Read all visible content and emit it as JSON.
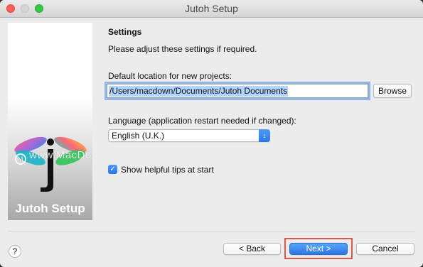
{
  "window": {
    "title": "Jutoh Setup"
  },
  "sidebar": {
    "label": "Jutoh Setup",
    "watermark": "www.MacDown.com",
    "watermark_mark": "M"
  },
  "settings": {
    "title": "Settings",
    "subtitle": "Please adjust these settings if required.",
    "location_label": "Default location for new projects:",
    "location_value": "/Users/macdown/Documents/Jutoh Documents",
    "browse_label": "Browse",
    "language_label": "Language (application restart needed if changed):",
    "language_value": "English (U.K.)",
    "tips_label": "Show helpful tips at start",
    "tips_checked": true
  },
  "footer": {
    "help_label": "?",
    "back_label": "< Back",
    "next_label": "Next >",
    "cancel_label": "Cancel"
  },
  "colors": {
    "accent": "#2a76e6",
    "highlight": "#d9574f"
  }
}
